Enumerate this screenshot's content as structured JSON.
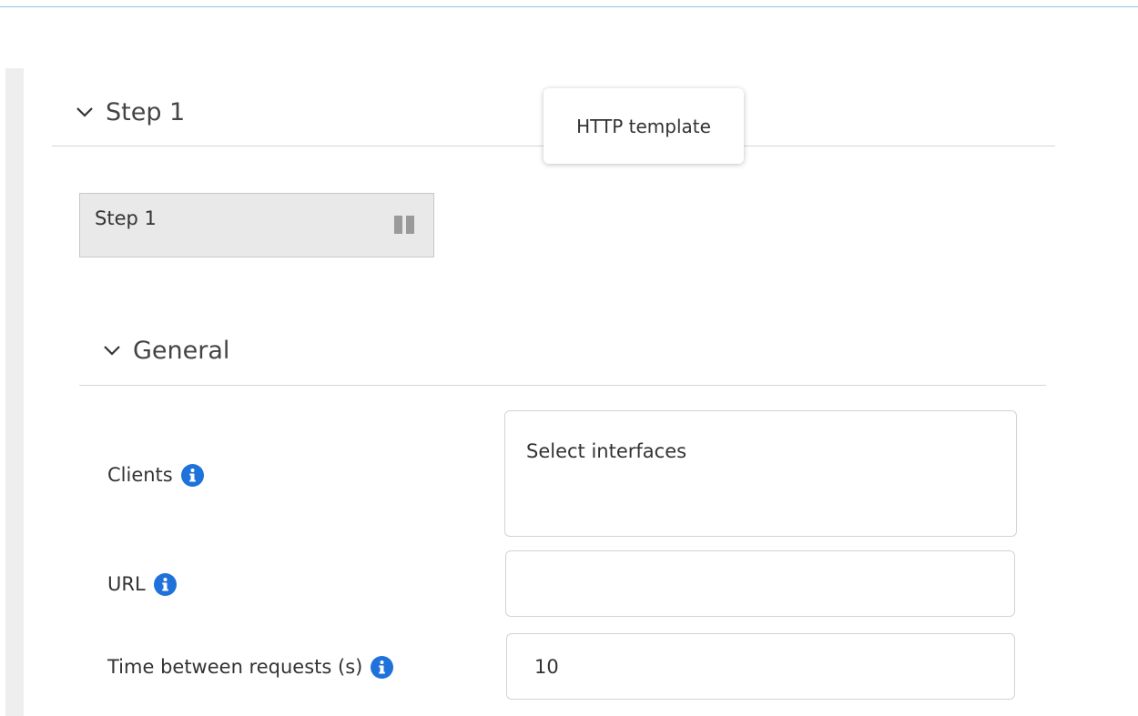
{
  "step_section": {
    "title": "Step 1",
    "tooltip": "HTTP template",
    "chip": {
      "label": "Step 1",
      "icon": "pause-icon"
    }
  },
  "general_section": {
    "title": "General",
    "fields": {
      "clients": {
        "label": "Clients",
        "placeholder": "Select interfaces",
        "icon": "info-icon"
      },
      "url": {
        "label": "URL",
        "value": "",
        "icon": "info-icon"
      },
      "time_between_requests": {
        "label": "Time between requests (s)",
        "value": "10",
        "icon": "info-icon"
      }
    }
  },
  "colors": {
    "accent": "#1e72d9",
    "top_rule": "#8ec3ea",
    "chip_bg": "#e9e9e9"
  }
}
